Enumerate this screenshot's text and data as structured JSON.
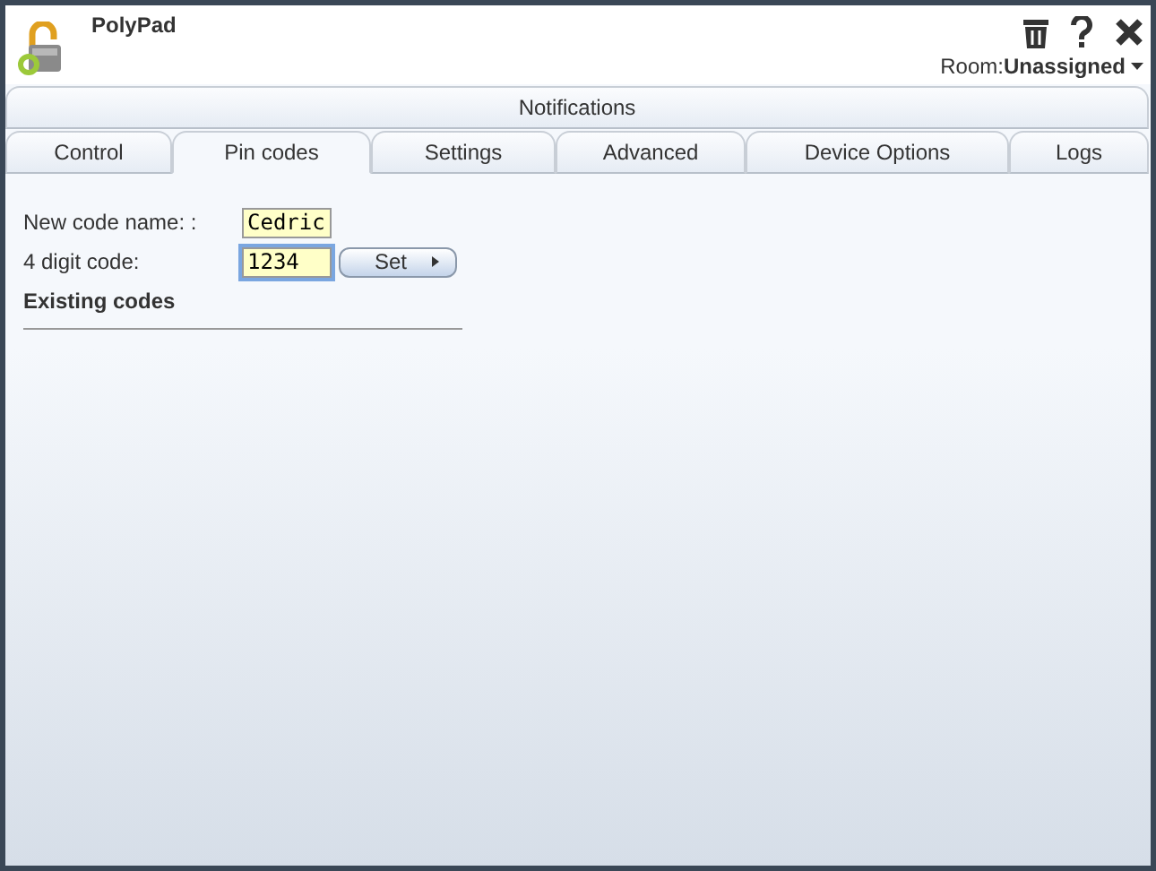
{
  "window": {
    "title": "PolyPad"
  },
  "room": {
    "label": "Room:",
    "value": "Unassigned"
  },
  "tab_rows": [
    [
      {
        "label": "Notifications",
        "selected": false
      }
    ],
    [
      {
        "label": "Control",
        "selected": false
      },
      {
        "label": "Pin codes",
        "selected": true
      },
      {
        "label": "Settings",
        "selected": false
      },
      {
        "label": "Advanced",
        "selected": false
      },
      {
        "label": "Device Options",
        "selected": false
      },
      {
        "label": "Logs",
        "selected": false
      }
    ]
  ],
  "form": {
    "name_label": "New code name: :",
    "name_value": "Cedric",
    "code_label": "4 digit code:",
    "code_value": "1234",
    "code_focused": true,
    "set_button": "Set",
    "existing_heading": "Existing codes"
  }
}
